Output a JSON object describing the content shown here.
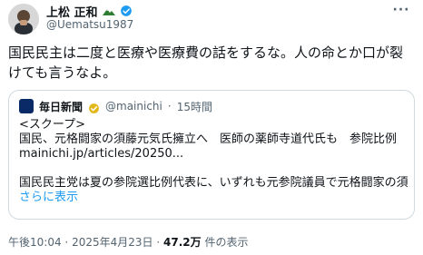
{
  "author": {
    "name": "上松 正和",
    "handle": "@Uematsu1987",
    "icons": {
      "avatar": "avatar-photo",
      "name_emoji": "mountain-emoji-icon",
      "verified": "verified-badge-icon",
      "more": "more-options-icon"
    },
    "more_glyph": "···"
  },
  "post": {
    "text": "国民民主は二度と医療や医療費の話をするな。人の命とか口が裂けても言うなよ。"
  },
  "quoted": {
    "source_name": "毎日新聞",
    "handle": "@mainichi",
    "separator": "·",
    "time": "15時間",
    "lines": [
      "<スクープ>",
      "国民、元格闘家の須藤元気氏擁立へ　医師の薬師寺道代氏も　参院比例",
      "mainichi.jp/articles/20250...",
      "",
      "国民民主党は夏の参院選比例代表に、いずれも元参院議員で元格闘家の須藤元..."
    ],
    "show_more": "さらに表示",
    "icons": {
      "logo": "mainichi-logo-icon",
      "verified": "gold-verified-badge-icon"
    }
  },
  "footer": {
    "time": "午後10:04",
    "sep1": "·",
    "date": "2025年4月23日",
    "sep2": "·",
    "views_value": "47.2万",
    "views_label": "件の表示"
  },
  "colors": {
    "text": "#0f1419",
    "secondary": "#536471",
    "border": "#cfd9de",
    "link": "#1d9bf0",
    "verified_blue": "#1d9bf0",
    "verified_gold": "#e2b719"
  }
}
